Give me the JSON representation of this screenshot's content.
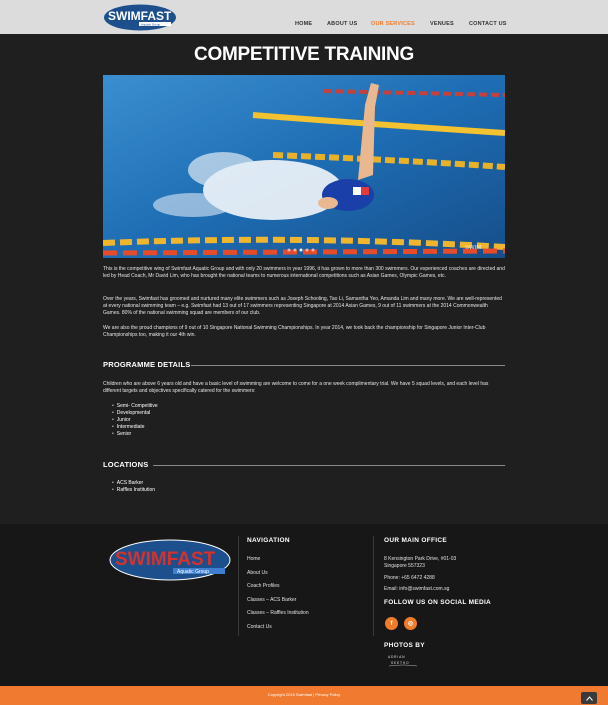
{
  "header": {
    "logo_text": "SWIMFAST",
    "logo_sub": "Aquatic Group",
    "nav": [
      {
        "label": "HOME"
      },
      {
        "label": "ABOUT US"
      },
      {
        "label": "OUR SERVICES"
      },
      {
        "label": "VENUES"
      },
      {
        "label": "CONTACT US"
      }
    ],
    "active_color": "#f07c2a"
  },
  "main": {
    "title": "COMPETITIVE TRAINING",
    "hero": {
      "watermark": "SWIM"
    },
    "paragraphs": [
      "This is the competitive wing of Swimfast Aquatic Group and with only 20 swimmers in year 1996, it has grown to more than 300 swimmers. Our experienced coaches are directed and led by Head Coach, Mr David Lim, who has brought the national teams to numerous international competitions such as Asian Games, Olympic Games, etc.",
      "Over the years, Swimfast has groomed and nurtured many elite swimmers such as Joseph Schooling, Tao Li, Samantha Yeo, Amanda Lim and many more. We are well-represented at every national swimming team – e.g. Swimfast had 13 out of 17 swimmers representing Singapore at 2014 Asian Games, 9 out of  11 swimmers at the 2014 Commonwealth Games. 80% of the national swimming squad are members of our club.",
      "We are also the proud champions of 9 out of 10 Singapore National Swimming Championships. In year 2014, we took back the championship for Singapore Junior Inter-Club Championships too, making it our 4th win."
    ],
    "programme": {
      "heading": "PROGRAMME DETAILS",
      "text": "Children who are above 6 years old and have a basic level of swimming are welcome to come for a one week complimentary trial. We have 5 squad levels, and each level has different targets and objectives specifically catered for the swimmers:",
      "levels": [
        "Semi- Competitive",
        "Developmental",
        "Junior",
        "Intermediate",
        "Senior"
      ]
    },
    "locations": {
      "heading": "LOCATIONS",
      "items": [
        "ACS Barker",
        "Raffles Institution"
      ]
    }
  },
  "footer": {
    "logo_text": "SWIMFAST",
    "logo_sub": "Aquatic Group",
    "nav_heading": "NAVIGATION",
    "nav_links": [
      "Home",
      "About Us",
      "Coach Profiles",
      "Classes – ACS Barker",
      "Classes – Raffles Institution",
      "Contact Us"
    ],
    "office_heading": "OUR MAIN OFFICE",
    "address_line1": "8 Kensington Park Drive, #01-03",
    "address_line2": "Singapore 557323",
    "phone": "Phone: +65 6472 4288",
    "email": "Email: info@swimfast.com.sg",
    "social_heading": "FOLLOW US ON SOCIAL MEDIA",
    "social": [
      {
        "icon": "facebook-icon",
        "glyph": "f"
      },
      {
        "icon": "instagram-icon",
        "glyph": "◎"
      }
    ],
    "photos_heading": "PHOTOS BY",
    "photos_credit": "ADRIAN SEETHO",
    "copyright": "Copyright 2015 Swimfast | Privacy Policy"
  },
  "colors": {
    "accent": "#f07c2a",
    "logo_blue": "#1c4f8c",
    "logo_red": "#d6322b"
  }
}
